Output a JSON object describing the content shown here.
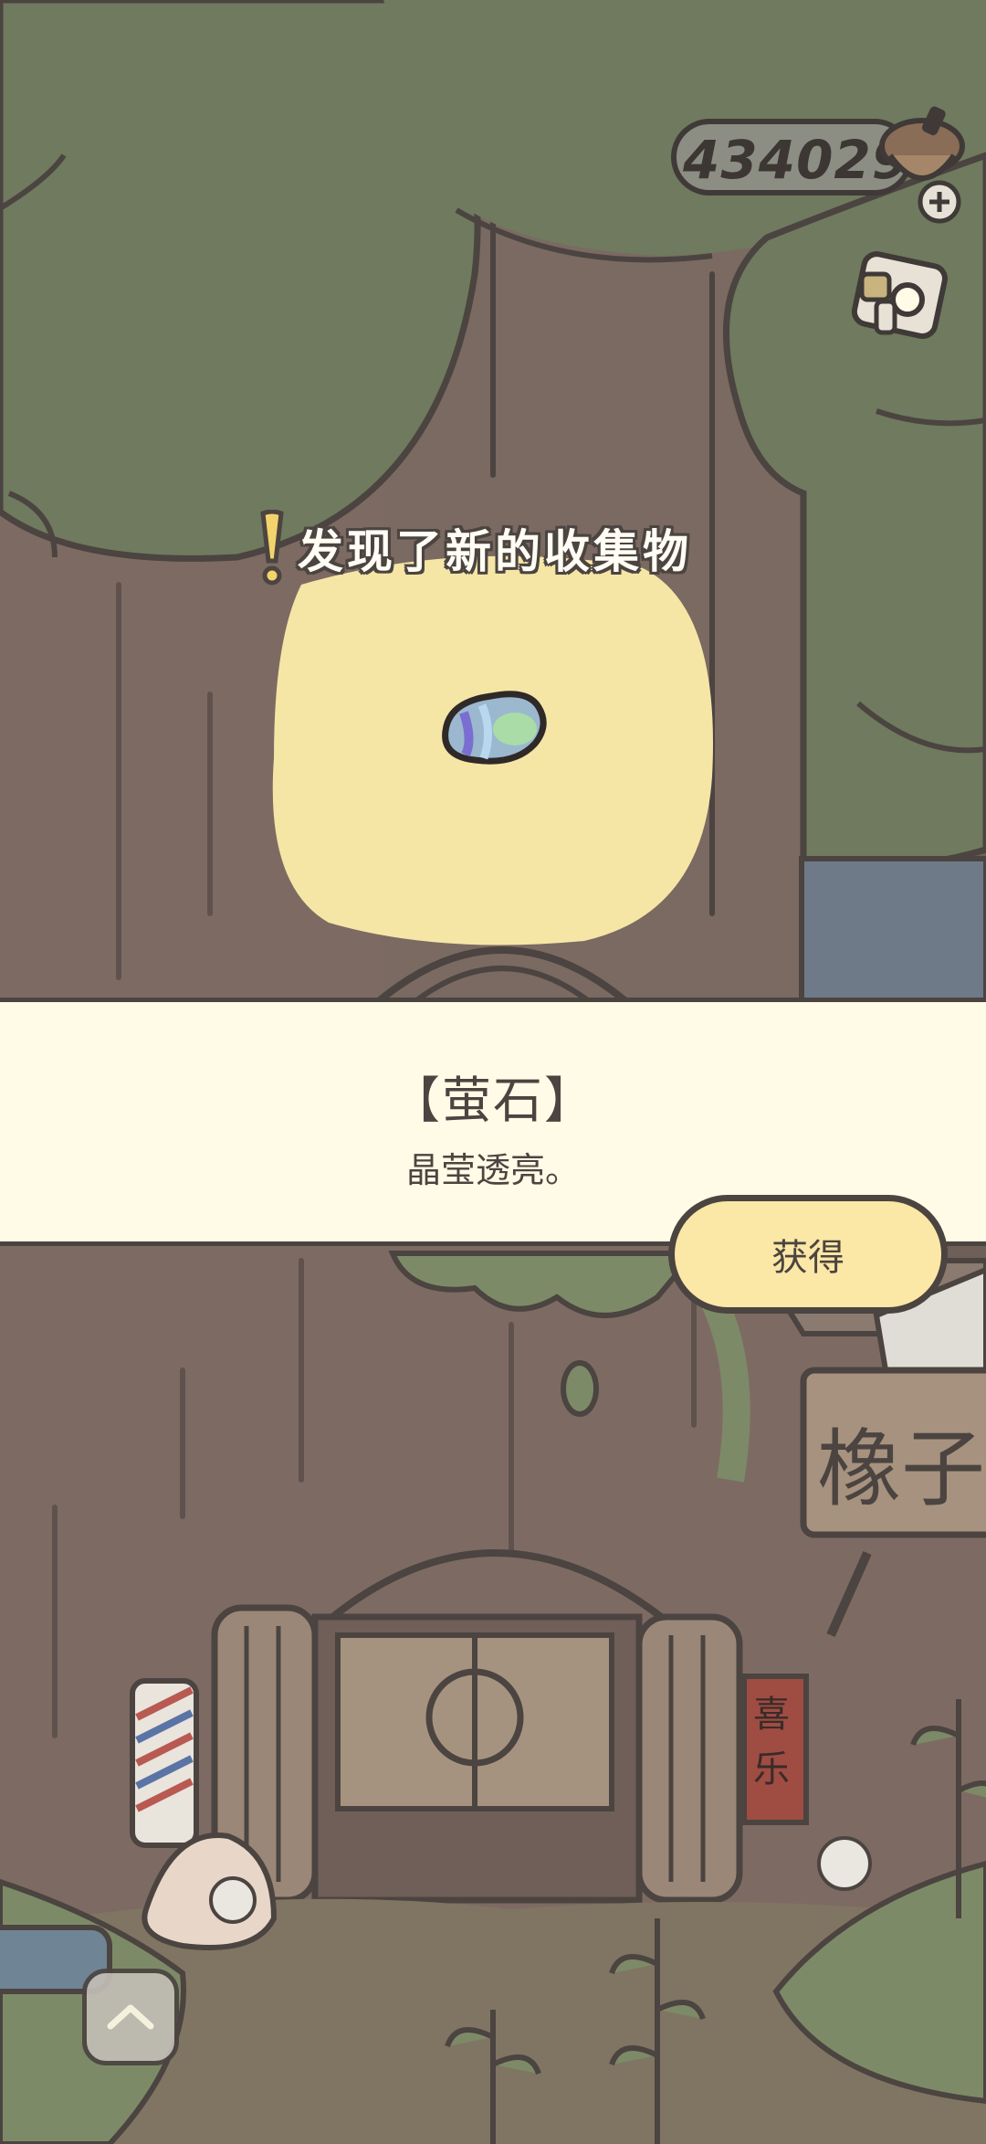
{
  "hud": {
    "acorn_count": "434029",
    "acorn_icon": "acorn-icon",
    "add_icon": "plus-icon",
    "camera_icon": "camera-icon"
  },
  "notification": {
    "text": "发现了新的收集物",
    "icon": "exclamation-icon"
  },
  "item": {
    "name": "【萤石】",
    "description": "晶莹透亮。",
    "icon": "fluorite-gem-icon"
  },
  "actions": {
    "get_label": "获得",
    "scroll_up_icon": "chevron-up-icon"
  },
  "scenery": {
    "shop_sign_text": "橡子",
    "couplet_text": "喜乐"
  },
  "colors": {
    "foliage": "#6f7a5e",
    "trunk": "#7b6a62",
    "panel": "#fffbe6",
    "button": "#fbe7a6",
    "highlight": "#f5e6a6",
    "outline": "#4b4440"
  }
}
